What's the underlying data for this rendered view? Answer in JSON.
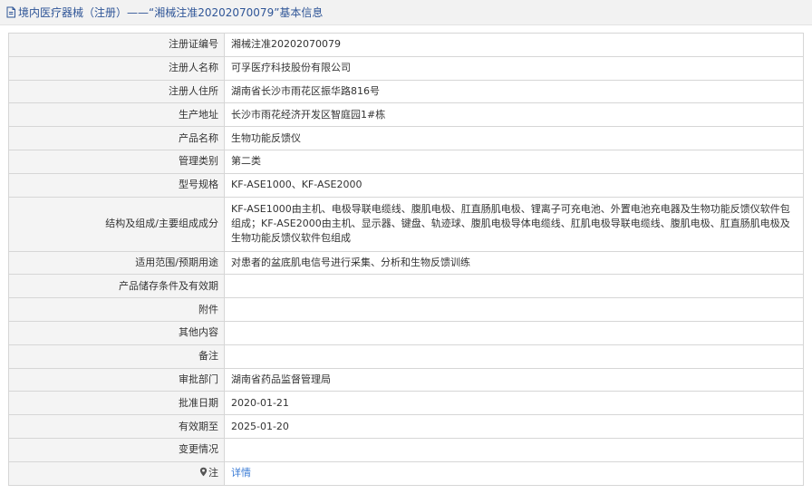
{
  "header": {
    "title": "境内医疗器械（注册）——“湘械注准20202070079”基本信息",
    "icon": "document-icon"
  },
  "rows": [
    {
      "label": "注册证编号",
      "value": "湘械注准20202070079"
    },
    {
      "label": "注册人名称",
      "value": "可孚医疗科技股份有限公司"
    },
    {
      "label": "注册人住所",
      "value": "湖南省长沙市雨花区振华路816号"
    },
    {
      "label": "生产地址",
      "value": "长沙市雨花经济开发区智庭园1#栋"
    },
    {
      "label": "产品名称",
      "value": "生物功能反馈仪"
    },
    {
      "label": "管理类别",
      "value": "第二类"
    },
    {
      "label": "型号规格",
      "value": "KF-ASE1000、KF-ASE2000"
    },
    {
      "label": "结构及组成/主要组成成分",
      "value": "KF-ASE1000由主机、电极导联电缆线、腹肌电极、肛直肠肌电极、锂离子可充电池、外置电池充电器及生物功能反馈仪软件包组成；KF-ASE2000由主机、显示器、键盘、轨迹球、腹肌电极导体电缆线、肛肌电极导联电缆线、腹肌电极、肛直肠肌电极及生物功能反馈仪软件包组成"
    },
    {
      "label": "适用范围/预期用途",
      "value": "对患者的盆底肌电信号进行采集、分析和生物反馈训练"
    },
    {
      "label": "产品储存条件及有效期",
      "value": ""
    },
    {
      "label": "附件",
      "value": ""
    },
    {
      "label": "其他内容",
      "value": ""
    },
    {
      "label": "备注",
      "value": ""
    },
    {
      "label": "审批部门",
      "value": "湖南省药品监督管理局"
    },
    {
      "label": "批准日期",
      "value": "2020-01-21"
    },
    {
      "label": "有效期至",
      "value": "2025-01-20"
    },
    {
      "label": "变更情况",
      "value": ""
    }
  ],
  "note_row": {
    "label": "注",
    "icon": "pin-icon",
    "link_label": "详情"
  },
  "colors": {
    "header_bg": "#f2f2f2",
    "title": "#2f5597",
    "label_bg": "#f4f4f4",
    "border": "#d6d6d6",
    "link": "#3a7bd5"
  }
}
